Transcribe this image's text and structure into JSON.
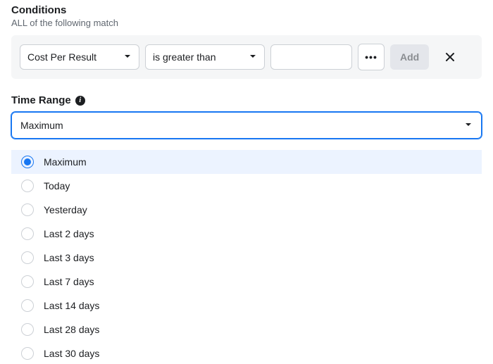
{
  "conditions": {
    "title": "Conditions",
    "subtitle": "ALL of the following match",
    "metric_label": "Cost Per Result",
    "operator_label": "is greater than",
    "value": "",
    "add_label": "Add"
  },
  "time_range": {
    "label": "Time Range",
    "selected": "Maximum",
    "options": [
      "Maximum",
      "Today",
      "Yesterday",
      "Last 2 days",
      "Last 3 days",
      "Last 7 days",
      "Last 14 days",
      "Last 28 days",
      "Last 30 days"
    ]
  }
}
